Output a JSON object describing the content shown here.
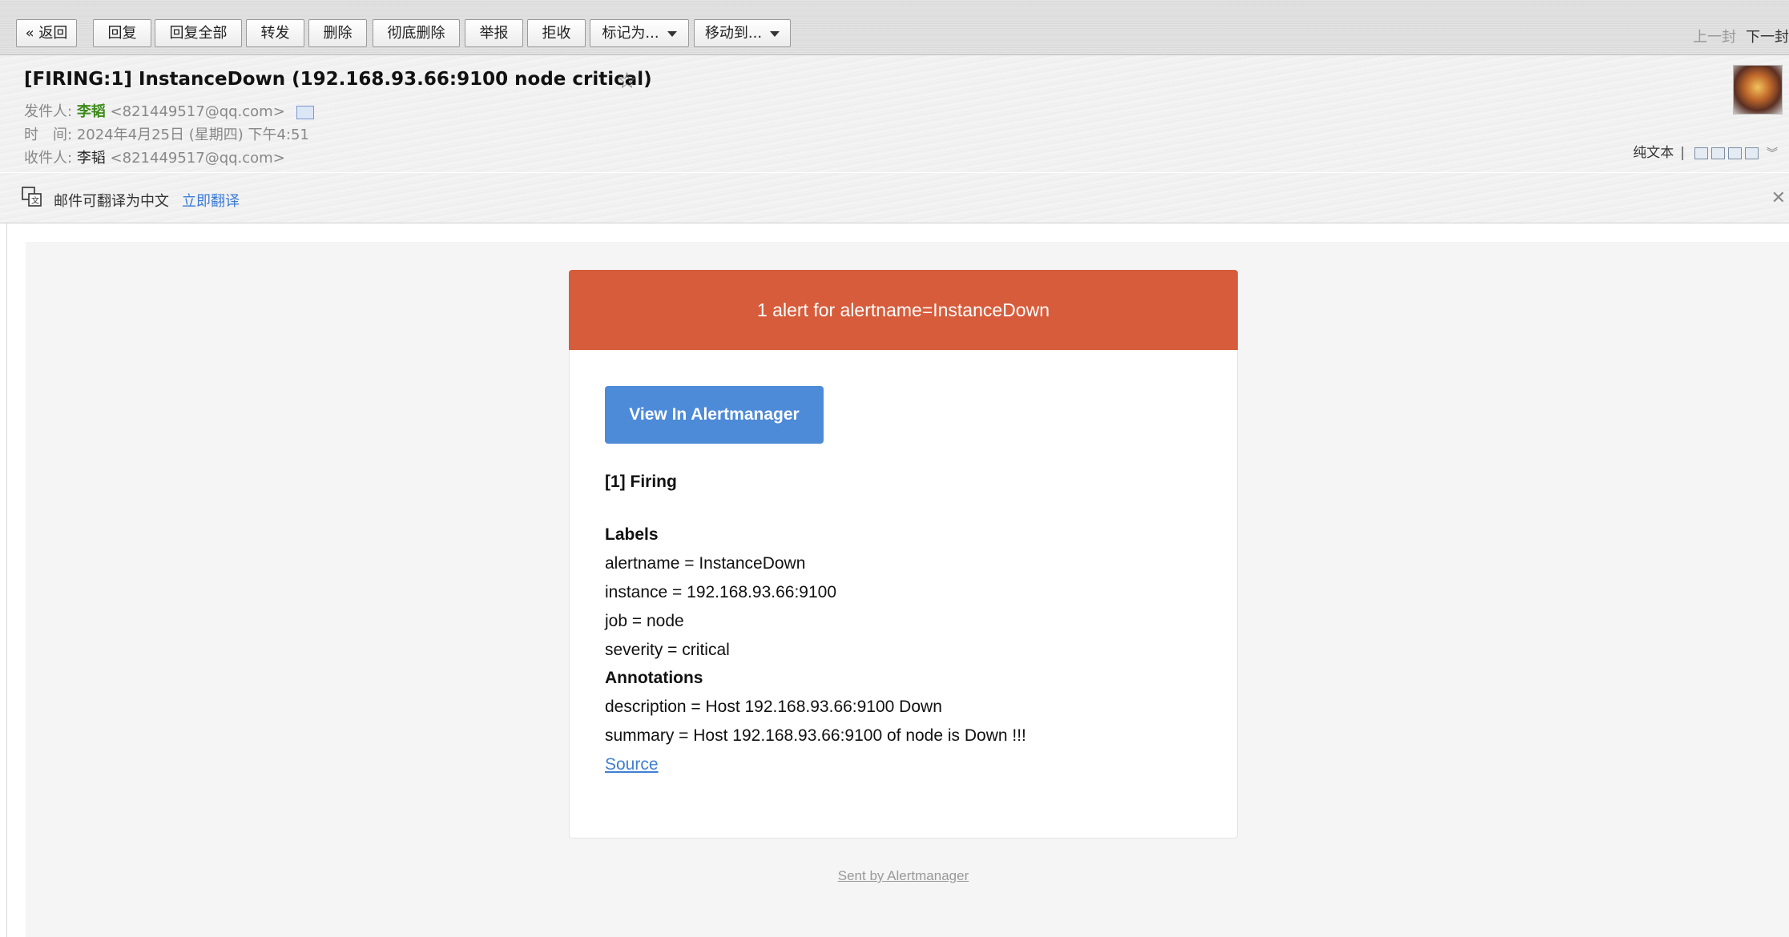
{
  "toolbar": {
    "back": "« 返回",
    "reply": "回复",
    "reply_all": "回复全部",
    "forward": "转发",
    "delete": "删除",
    "delete_permanent": "彻底删除",
    "report": "举报",
    "reject": "拒收",
    "mark_as": "标记为...",
    "move_to": "移动到...",
    "prev": "上一封",
    "next": "下一封"
  },
  "header": {
    "subject": "[FIRING:1] InstanceDown (192.168.93.66:9100 node critical)",
    "from_label": "发件人:",
    "from_name": "李韬",
    "from_email": "<821449517@qq.com>",
    "time_label": "时　间:",
    "time_value": "2024年4月25日 (星期四) 下午4:51",
    "to_label": "收件人:",
    "to_name": "李韬",
    "to_email": "<821449517@qq.com>",
    "plain_text": "纯文本",
    "separator": "|"
  },
  "translate": {
    "text": "邮件可翻译为中文",
    "link": "立即翻译"
  },
  "email": {
    "banner": "1 alert for alertname=InstanceDown",
    "button": "View In Alertmanager",
    "firing": "[1] Firing",
    "labels_heading": "Labels",
    "label_alertname": "alertname = InstanceDown",
    "label_instance": "instance = 192.168.93.66:9100",
    "label_job": "job = node",
    "label_severity": "severity = critical",
    "annotations_heading": "Annotations",
    "annotation_description": "description = Host 192.168.93.66:9100 Down",
    "annotation_summary": "summary = Host 192.168.93.66:9100 of node is Down !!!",
    "source": "Source",
    "footer": "Sent by Alertmanager"
  },
  "colors": {
    "banner": "#d75c3b",
    "button": "#4d8ad8",
    "link": "#3f7fd2",
    "sender_name": "#3d8b1d"
  },
  "icons": [
    "star-icon",
    "vcard-icon",
    "translate-icon",
    "close-icon",
    "avatar"
  ]
}
